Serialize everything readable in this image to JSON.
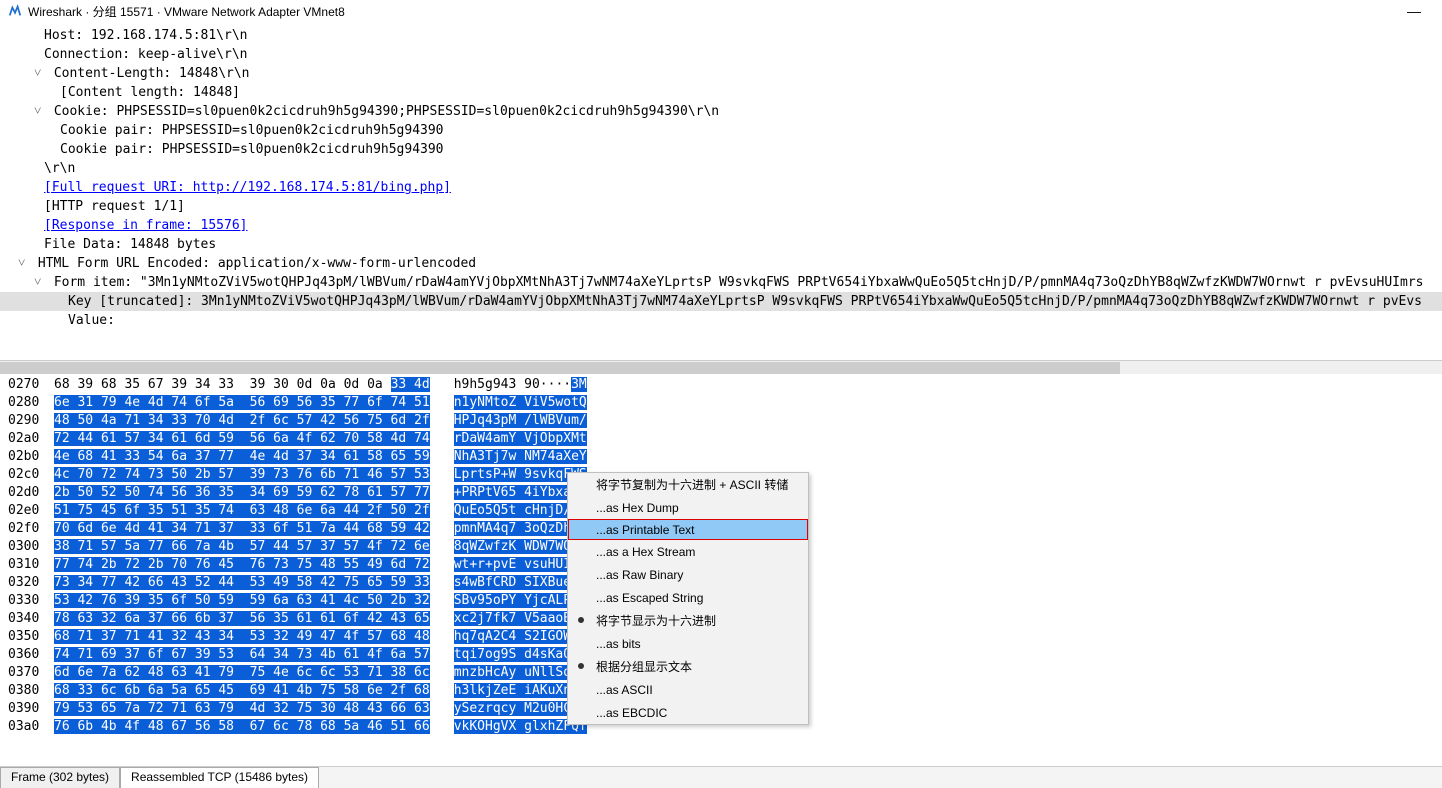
{
  "window": {
    "title": "Wireshark · 分组 15571 · VMware Network Adapter VMnet8"
  },
  "detail": {
    "host": "Host: 192.168.174.5:81\\r\\n",
    "connection": "Connection: keep-alive\\r\\n",
    "content_length": "Content-Length: 14848\\r\\n",
    "content_length_inner": "[Content length: 14848]",
    "cookie": "Cookie: PHPSESSID=sl0puen0k2cicdruh9h5g94390;PHPSESSID=sl0puen0k2cicdruh9h5g94390\\r\\n",
    "cookie_pair1": "Cookie pair: PHPSESSID=sl0puen0k2cicdruh9h5g94390",
    "cookie_pair2": "Cookie pair: PHPSESSID=sl0puen0k2cicdruh9h5g94390",
    "rn": "\\r\\n",
    "full_uri": "[Full request URI: http://192.168.174.5:81/bing.php]",
    "http_req": "[HTTP request 1/1]",
    "response": "[Response in frame: 15576]",
    "file_data": "File Data: 14848 bytes",
    "form_header": "HTML Form URL Encoded: application/x-www-form-urlencoded",
    "form_item": "Form item: \"3Mn1yNMtoZViV5wotQHPJq43pM/lWBVum/rDaW4amYVjObpXMtNhA3Tj7wNM74aXeYLprtsP W9svkqFWS PRPtV654iYbxaWwQuEo5Q5tcHnjD/P/pmnMA4q73oQzDhYB8qWZwfzKWDW7WOrnwt r pvEvsuHUImrs",
    "key": "Key [truncated]: 3Mn1yNMtoZViV5wotQHPJq43pM/lWBVum/rDaW4amYVjObpXMtNhA3Tj7wNM74aXeYLprtsP W9svkqFWS PRPtV654iYbxaWwQuEo5Q5tcHnjD/P/pmnMA4q73oQzDhYB8qWZwfzKWDW7WOrnwt r pvEvs",
    "value": "Value:"
  },
  "hex": {
    "rows": [
      {
        "off": "0270",
        "b1": "68 39 68 35 67 39 34 33",
        "b2": "39 30 0d 0a 0d 0a",
        "b2s": "33 4d",
        "a1": "h9h5g943 90····",
        "a1s": "3M"
      },
      {
        "off": "0280",
        "b1s": "6e 31 79 4e 4d 74 6f 5a  56 69 56 35 77 6f 74 51",
        "a1s": "n1yNMtoZ ViV5wotQ"
      },
      {
        "off": "0290",
        "b1s": "48 50 4a 71 34 33 70 4d  2f 6c 57 42 56 75 6d 2f",
        "a1s": "HPJq43pM /lWBVum/"
      },
      {
        "off": "02a0",
        "b1s": "72 44 61 57 34 61 6d 59  56 6a 4f 62 70 58 4d 74",
        "a1s": "rDaW4amY VjObpXMt"
      },
      {
        "off": "02b0",
        "b1s": "4e 68 41 33 54 6a 37 77  4e 4d 37 34 61 58 65 59",
        "a1s": "NhA3Tj7w NM74aXeY"
      },
      {
        "off": "02c0",
        "b1s": "4c 70 72 74 73 50 2b 57  39 73 76 6b 71 46 57 53",
        "a1s": "LprtsP+W 9svkqFWS"
      },
      {
        "off": "02d0",
        "b1s": "2b 50 52 50 74 56 36 35  34 69 59 62 78 61 57 77",
        "a1s": "+PRPtV65 4iYbxaWw"
      },
      {
        "off": "02e0",
        "b1s": "51 75 45 6f 35 51 35 74  63 48 6e 6a 44 2f 50 2f",
        "a1s": "QuEo5Q5t cHnjD/P/"
      },
      {
        "off": "02f0",
        "b1s": "70 6d 6e 4d 41 34 71 37  33 6f 51 7a 44 68 59 42",
        "a1s": "pmnMA4q7 3oQzDhYB"
      },
      {
        "off": "0300",
        "b1s": "38 71 57 5a 77 66 7a 4b  57 44 57 37 57 4f 72 6e",
        "a1s": "8qWZwfzK WDW7WOrn"
      },
      {
        "off": "0310",
        "b1s": "77 74 2b 72 2b 70 76 45  76 73 75 48 55 49 6d 72",
        "a1s": "wt+r+pvE vsuHUImr"
      },
      {
        "off": "0320",
        "b1s": "73 34 77 42 66 43 52 44  53 49 58 42 75 65 59 33",
        "a1s": "s4wBfCRD SIXBueY3"
      },
      {
        "off": "0330",
        "b1s": "53 42 76 39 35 6f 50 59  59 6a 63 41 4c 50 2b 32",
        "a1s": "SBv95oPY YjcALP+2"
      },
      {
        "off": "0340",
        "b1s": "78 63 32 6a 37 66 6b 37  56 35 61 61 6f 42 43 65",
        "a1s": "xc2j7fk7 V5aaoBCe"
      },
      {
        "off": "0350",
        "b1s": "68 71 37 71 41 32 43 34  53 32 49 47 4f 57 68 48",
        "a1s": "hq7qA2C4 S2IGOWhH"
      },
      {
        "off": "0360",
        "b1s": "74 71 69 37 6f 67 39 53  64 34 73 4b 61 4f 6a 57",
        "a1s": "tqi7og9S d4sKaOjW"
      },
      {
        "off": "0370",
        "b1s": "6d 6e 7a 62 48 63 41 79  75 4e 6c 6c 53 71 38 6c",
        "a1s": "mnzbHcAy uNllSq8l"
      },
      {
        "off": "0380",
        "b1s": "68 33 6c 6b 6a 5a 65 45  69 41 4b 75 58 6e 2f 68",
        "a1s": "h3lkjZeE iAKuXn/h"
      },
      {
        "off": "0390",
        "b1s": "79 53 65 7a 72 71 63 79  4d 32 75 30 48 43 66 63",
        "a1s": "ySezrqcy M2u0HCfc"
      },
      {
        "off": "03a0",
        "b1s": "76 6b 4b 4f 48 67 56 58  67 6c 78 68 5a 46 51 66",
        "a1s": "vkKOHgVX glxhZFQf"
      }
    ]
  },
  "menu": {
    "header": "将字节复制为十六进制 + ASCII 转储",
    "hexdump": "...as Hex Dump",
    "printable": "...as Printable Text",
    "hexstream": "...as a Hex Stream",
    "rawbinary": "...as Raw Binary",
    "escaped": "...as Escaped String",
    "show_hex": "将字节显示为十六进制",
    "bits": "...as bits",
    "show_text": "根据分组显示文本",
    "ascii": "...as ASCII",
    "ebcdic": "...as EBCDIC"
  },
  "tabs": {
    "frame": "Frame (302 bytes)",
    "reassembled": "Reassembled TCP (15486 bytes)"
  }
}
